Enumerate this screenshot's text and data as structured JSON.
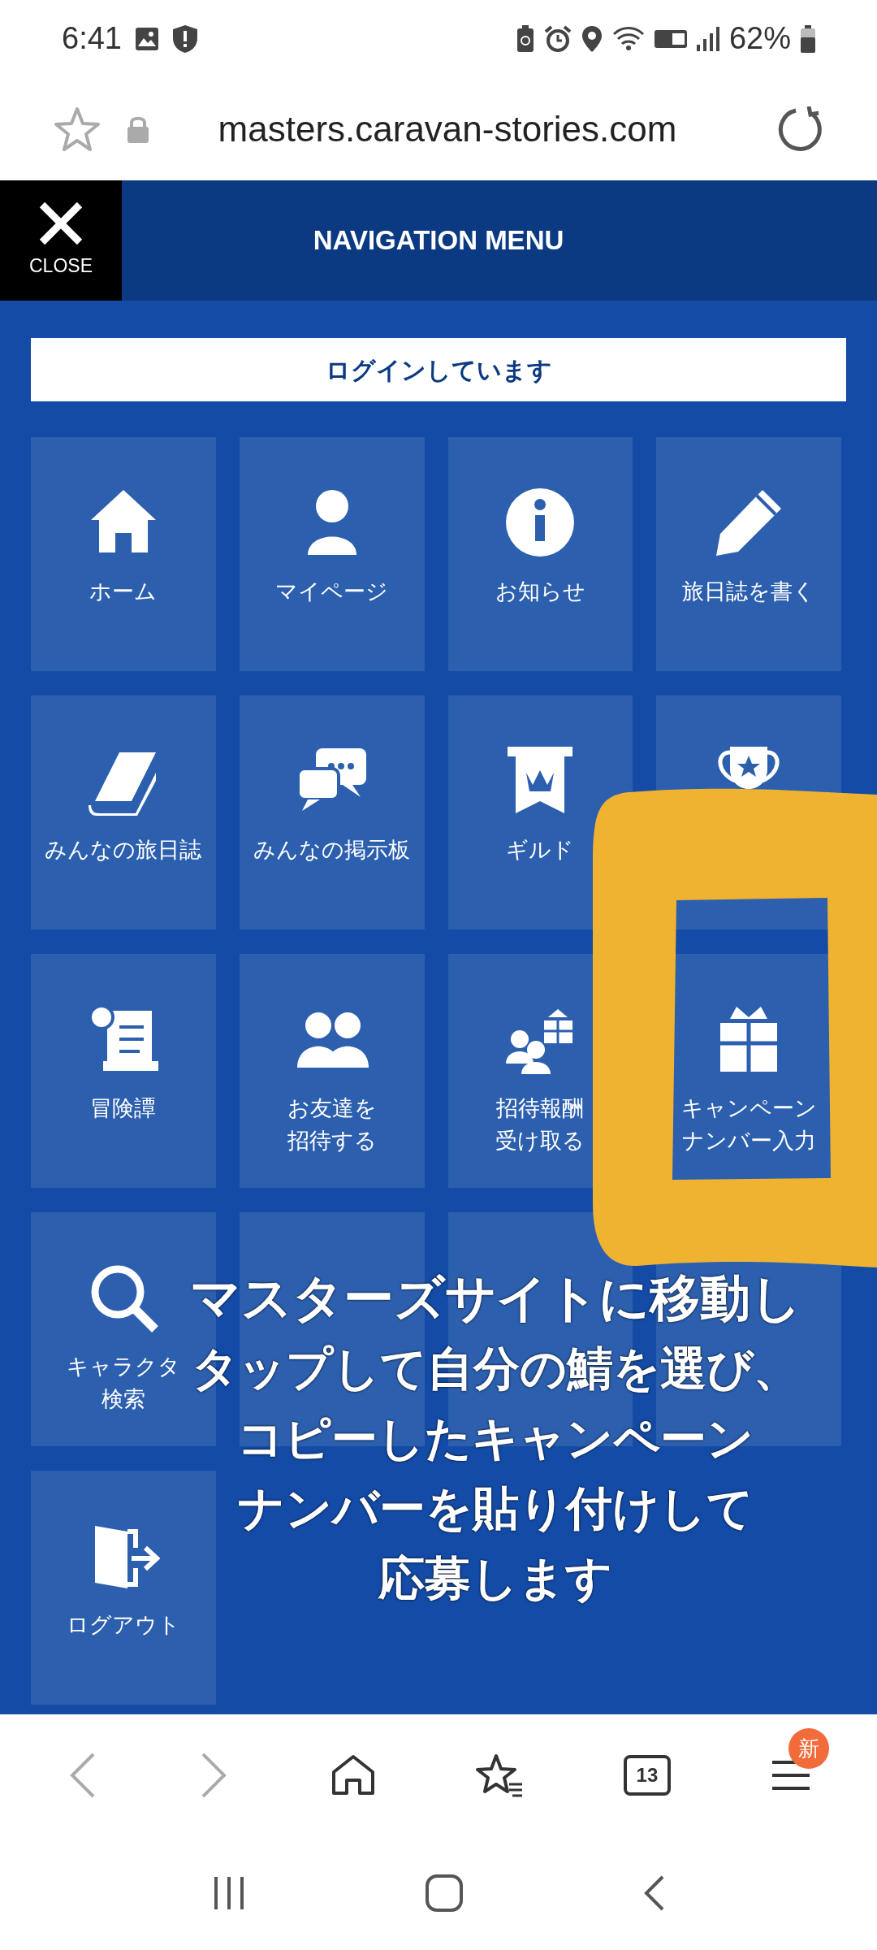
{
  "status_bar": {
    "time": "6:41",
    "battery": "62%"
  },
  "url_bar": {
    "url": "masters.caravan-stories.com"
  },
  "header": {
    "close_label": "CLOSE",
    "title": "NAVIGATION MENU"
  },
  "login_banner": "ログインしています",
  "tiles": [
    {
      "lines": [
        "ホーム"
      ]
    },
    {
      "lines": [
        "マイページ"
      ]
    },
    {
      "lines": [
        "お知らせ"
      ]
    },
    {
      "lines": [
        "旅日誌を書く"
      ]
    },
    {
      "lines": [
        "みんなの旅日誌"
      ]
    },
    {
      "lines": [
        "みんなの掲示板"
      ]
    },
    {
      "lines": [
        "ギルド"
      ]
    },
    {
      "kind": "icon_only"
    },
    {
      "lines": [
        "冒険譚"
      ]
    },
    {
      "lines": [
        "お友達を",
        "招待する"
      ]
    },
    {
      "lines": [
        "招待報酬",
        "受け取る"
      ]
    },
    {
      "lines": [
        "キャンペーン",
        "ナンバー入力"
      ]
    },
    {
      "lines": [
        "キャラクタ",
        "検索"
      ]
    },
    {
      "kind": "blank"
    },
    {
      "kind": "blank"
    },
    {
      "kind": "blank"
    },
    {
      "lines": [
        "ログアウト"
      ]
    }
  ],
  "annotation": {
    "caption": [
      "マスターズサイトに移動し",
      "タップして自分の鯖を選び、",
      "コピーしたキャンペーン",
      "ナンバーを貼り付けして",
      "応募します"
    ]
  },
  "bottom_nav": {
    "tab_count": "13",
    "menu_badge": "新"
  }
}
